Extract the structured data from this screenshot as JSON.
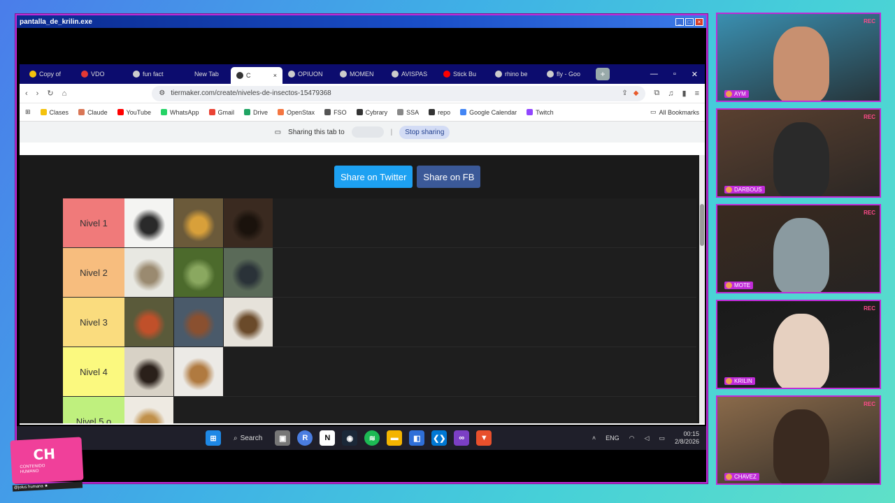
{
  "window": {
    "title": "pantalla_de_krilin.exe"
  },
  "browser": {
    "tabs": [
      {
        "label": "Copy of",
        "color": "#f4c20d"
      },
      {
        "label": "VDO",
        "color": "#e53935"
      },
      {
        "label": "fun fact",
        "color": "#cccccc"
      },
      {
        "label": "New Tab",
        "color": "#0c0c6e"
      },
      {
        "label": "C",
        "color": "#333333",
        "active": true
      },
      {
        "label": "OPIUON",
        "color": "#cccccc"
      },
      {
        "label": "MOMEN",
        "color": "#cccccc"
      },
      {
        "label": "AVISPAS",
        "color": "#cccccc"
      },
      {
        "label": "Stick Bu",
        "color": "#ff0000"
      },
      {
        "label": "rhino be",
        "color": "#cccccc"
      },
      {
        "label": "fly - Goo",
        "color": "#cccccc"
      }
    ],
    "new_tab_symbol": "+",
    "url": "tiermaker.com/create/niveles-de-insectos-15479368",
    "bookmarks": [
      {
        "label": "Clases",
        "color": "#f4c20d"
      },
      {
        "label": "Claude",
        "color": "#d97757"
      },
      {
        "label": "YouTube",
        "color": "#ff0000"
      },
      {
        "label": "WhatsApp",
        "color": "#25d366"
      },
      {
        "label": "Gmail",
        "color": "#ea4335"
      },
      {
        "label": "Drive",
        "color": "#1fa463"
      },
      {
        "label": "OpenStax",
        "color": "#f47641"
      },
      {
        "label": "FSO",
        "color": "#555555"
      },
      {
        "label": "Cybrary",
        "color": "#333333"
      },
      {
        "label": "SSA",
        "color": "#888888"
      },
      {
        "label": "repo",
        "color": "#333333"
      },
      {
        "label": "Google Calendar",
        "color": "#4285f4"
      },
      {
        "label": "Twitch",
        "color": "#9146ff"
      }
    ],
    "all_bookmarks": "All Bookmarks",
    "sharing": {
      "text": "Sharing this tab to",
      "stop": "Stop sharing"
    }
  },
  "page": {
    "share_twitter": "Share on Twitter",
    "share_fb": "Share on FB",
    "tiers": [
      {
        "label": "Nivel 1",
        "color": "#f07a7a",
        "items": [
          "ant",
          "bee",
          "rhinoceros-beetle"
        ]
      },
      {
        "label": "Nivel 2",
        "color": "#f7bd7e",
        "items": [
          "spider",
          "stick-bug",
          "fly"
        ]
      },
      {
        "label": "Nivel 3",
        "color": "#fadc7e",
        "items": [
          "wasp",
          "tarantula",
          "scorpion"
        ]
      },
      {
        "label": "Nivel 4",
        "color": "#fbf97f",
        "items": [
          "cricket",
          "snail"
        ]
      },
      {
        "label": "Nivel 5 o",
        "color": "#bff07e",
        "items": [
          "caterpillar"
        ]
      }
    ]
  },
  "taskbar": {
    "search": "Search",
    "lang": "ENG",
    "time": "00:15",
    "date": "2/8/2026"
  },
  "cams": [
    {
      "name": "AYM",
      "rec": "REC"
    },
    {
      "name": "DARBOUS",
      "rec": "REC"
    },
    {
      "name": "MOTE",
      "rec": "REC"
    },
    {
      "name": "KRILIN",
      "rec": "REC"
    },
    {
      "name": "CHAVEZ",
      "rec": "REC"
    }
  ],
  "logo": {
    "title": "CH",
    "subtitle": "CONTENIDO HUMANO",
    "footer": "@jolus humana ★"
  }
}
